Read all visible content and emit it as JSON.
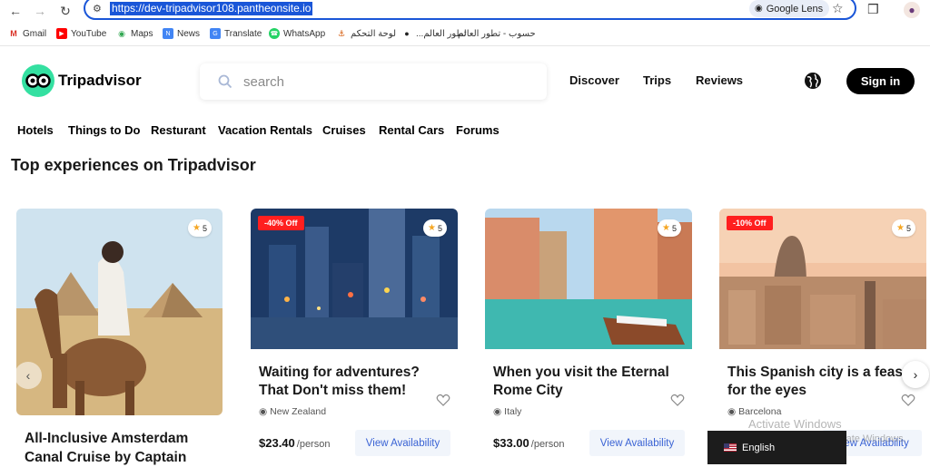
{
  "browser": {
    "url": "https://dev-tripadvisor108.pantheonsite.io",
    "lens_label": "Google Lens",
    "bookmarks": [
      {
        "label": "Gmail",
        "icon": "gmail-icon"
      },
      {
        "label": "YouTube",
        "icon": "youtube-icon"
      },
      {
        "label": "Maps",
        "icon": "maps-icon"
      },
      {
        "label": "News",
        "icon": "news-icon"
      },
      {
        "label": "Translate",
        "icon": "translate-icon"
      },
      {
        "label": "WhatsApp",
        "icon": "whatsapp-icon"
      },
      {
        "label": "لوحة التحكم",
        "icon": "dashboard-icon"
      },
      {
        "label": "...تطور العالم",
        "icon": "bookmark-icon"
      },
      {
        "label": "حسوب - تطور العالم",
        "icon": "hsoub-icon"
      }
    ]
  },
  "header": {
    "logo_text": "Tripadvisor",
    "search_placeholder": "search",
    "nav": [
      "Discover",
      "Trips",
      "Reviews"
    ],
    "signin_label": "Sign in"
  },
  "categories": [
    "Hotels",
    "Things to Do",
    "Resturant",
    "Vacation Rentals",
    "Cruises",
    "Rental Cars",
    "Forums"
  ],
  "section_title": "Top experiences on Tripadvisor",
  "cards": [
    {
      "title": "All-Inclusive Amsterdam Canal Cruise by Captain",
      "rating": "5"
    },
    {
      "title": "Waiting for adventures? That Don't miss them!",
      "rating": "5",
      "badge": "-40% Off",
      "location": "New Zealand",
      "price": "$23.40",
      "per": "/person",
      "cta": "View Availability"
    },
    {
      "title": "When you visit the Eternal Rome City",
      "rating": "5",
      "location": "Italy",
      "price": "$33.00",
      "per": "/person",
      "cta": "View Availability"
    },
    {
      "title": "This Spanish city is a feas for the eyes",
      "rating": "5",
      "badge": "-10% Off",
      "location": "Barcelona",
      "cta": "View Availability"
    }
  ],
  "overlay": {
    "watermark_title": "Activate Windows",
    "watermark_sub": "Go to Settings to activate Windows.",
    "language": "English"
  },
  "colors": {
    "brand_green": "#34e0a1",
    "badge_red": "#ff1f1f",
    "link_blue": "#3a63d4",
    "rating_star": "#f5a623"
  }
}
